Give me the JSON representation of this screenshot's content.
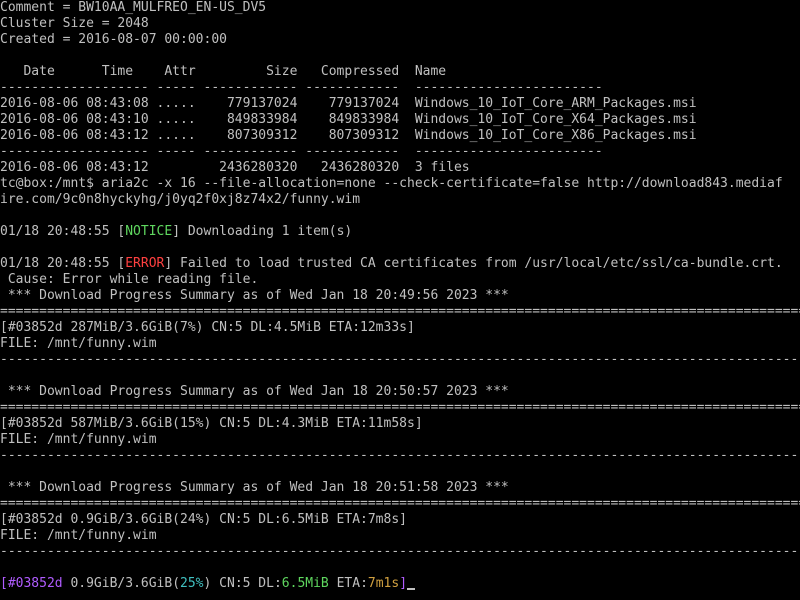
{
  "archive": {
    "comment": "Comment = BW10AA_MULFREO_EN-US_DV5",
    "cluster_size": "Cluster Size = 2048",
    "created": "Created = 2016-08-07 00:00:00",
    "header": "   Date      Time    Attr         Size   Compressed  Name",
    "separator": "------------------- ----- ------------ ------------  ------------------------",
    "files": [
      "2016-08-06 08:43:08 .....    779137024    779137024  Windows_10_IoT_Core_ARM_Packages.msi",
      "2016-08-06 08:43:10 .....    849833984    849833984  Windows_10_IoT_Core_X64_Packages.msi",
      "2016-08-06 08:43:12 .....    807309312    807309312  Windows_10_IoT_Core_X86_Packages.msi"
    ],
    "total": "2016-08-06 08:43:12         2436280320   2436280320  3 files"
  },
  "command": {
    "line1": "tc@box:/mnt$ aria2c -x 16 --file-allocation=none --check-certificate=false http://download843.mediaf",
    "line2": "ire.com/9c0n8hyckyhg/j0yq2f0xj8z74x2/funny.wim"
  },
  "notice": {
    "time": "01/18 20:48:55 ",
    "open": "[",
    "tag": "NOTICE",
    "close": "]",
    "text": " Downloading 1 item(s)"
  },
  "error": {
    "time": "01/18 20:48:55 ",
    "open": "[",
    "tag": "ERROR",
    "close": "]",
    "text": " Failed to load trusted CA certificates from /usr/local/etc/ssl/ca-bundle.crt.",
    "cause": " Cause: Error while reading file."
  },
  "summaries": [
    {
      "heading": " *** Download Progress Summary as of Wed Jan 18 20:49:56 2023 ***",
      "status": "[#03852d 287MiB/3.6GiB(7%) CN:5 DL:4.5MiB ETA:12m33s]",
      "file": "FILE: /mnt/funny.wim"
    },
    {
      "heading": " *** Download Progress Summary as of Wed Jan 18 20:50:57 2023 ***",
      "status": "[#03852d 587MiB/3.6GiB(15%) CN:5 DL:4.3MiB ETA:11m58s]",
      "file": "FILE: /mnt/funny.wim"
    },
    {
      "heading": " *** Download Progress Summary as of Wed Jan 18 20:51:58 2023 ***",
      "status": "[#03852d 0.9GiB/3.6GiB(24%) CN:5 DL:6.5MiB ETA:7m8s]",
      "file": "FILE: /mnt/funny.wim"
    }
  ],
  "rule_eq": "==========================================================================================================",
  "rule_dash": "----------------------------------------------------------------------------------------------------------",
  "live_progress": {
    "open": "[",
    "gid": "#03852d",
    "sizes": " 0.9GiB/3.6GiB(",
    "percent": "25%",
    "close_paren": ")",
    "conn": " CN:5 DL:",
    "speed": "6.5MiB",
    "eta_label": " ETA:",
    "eta": "7m1s",
    "close": "]"
  },
  "colors": {
    "background": "#000000",
    "text": "#c0c0c0",
    "notice": "#5fd75f",
    "error": "#ff4040",
    "gid": "#b05cff",
    "percent": "#40c0c0",
    "speed": "#5fd75f",
    "eta": "#d0a040"
  }
}
